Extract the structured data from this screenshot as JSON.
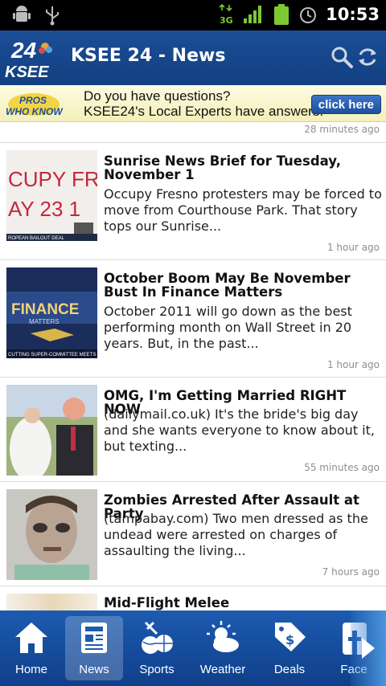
{
  "status_bar": {
    "time": "10:53",
    "network": "3G",
    "icons": [
      "android-debug-icon",
      "usb-icon",
      "network-3g-icon",
      "signal-icon",
      "battery-icon",
      "alarm-icon"
    ]
  },
  "header": {
    "logo_text_top": "24",
    "logo_text_bottom": "KSEE",
    "title": "KSEE 24 - News",
    "icons": [
      "search-icon",
      "refresh-icon"
    ]
  },
  "banner": {
    "logo_line1": "PROS",
    "logo_line2": "WHO KNOW",
    "line1": "Do you have questions?",
    "line2": "KSEE24's Local Experts have answers.",
    "button": "click here"
  },
  "news": {
    "top_timestamp": "28 minutes ago",
    "items": [
      {
        "headline": "Sunrise News Brief for Tuesday, November 1",
        "summary": "Occupy Fresno protesters may be forced to move from Courthouse Park. That story tops our Sunrise...",
        "timestamp": "1 hour ago",
        "thumb_text": "CUPY FR",
        "thumb_text2": "AY 23 1",
        "thumb_caption": "ROPEAN BAILOUT DEAL"
      },
      {
        "headline": "October Boom May Be November Bust In Finance Matters",
        "summary": "October 2011 will go down as the best performing month on Wall Street in 20 years. But, in the past...",
        "timestamp": "1 hour ago",
        "thumb_text": "FINANCE",
        "thumb_text2": "MATTERS",
        "thumb_caption": "CUTTING SUPER-COMMITTEE MEETS"
      },
      {
        "headline": "OMG, I'm Getting Married RIGHT NOW",
        "summary": "(dailymail.co.uk) It's the bride's big day and she wants everyone to know about it, but texting...",
        "timestamp": "55 minutes ago"
      },
      {
        "headline": "Zombies Arrested After Assault at Party",
        "summary": "(tampabay.com) Two men dressed as the undead were arrested on charges of assaulting the living...",
        "timestamp": "7 hours ago"
      },
      {
        "headline": "Mid-Flight Melee"
      }
    ]
  },
  "tabs": [
    {
      "label": "Home",
      "icon": "home-icon",
      "selected": false
    },
    {
      "label": "News",
      "icon": "news-icon",
      "selected": true
    },
    {
      "label": "Sports",
      "icon": "sports-icon",
      "selected": false
    },
    {
      "label": "Weather",
      "icon": "weather-icon",
      "selected": false
    },
    {
      "label": "Deals",
      "icon": "deals-icon",
      "selected": false
    },
    {
      "label": "Face",
      "icon": "facebook-icon",
      "selected": false
    }
  ],
  "colors": {
    "header_blue": "#1b4e97",
    "tab_bar_blue": "#1d5bb0",
    "timestamp_gray": "#8e8e8e"
  }
}
